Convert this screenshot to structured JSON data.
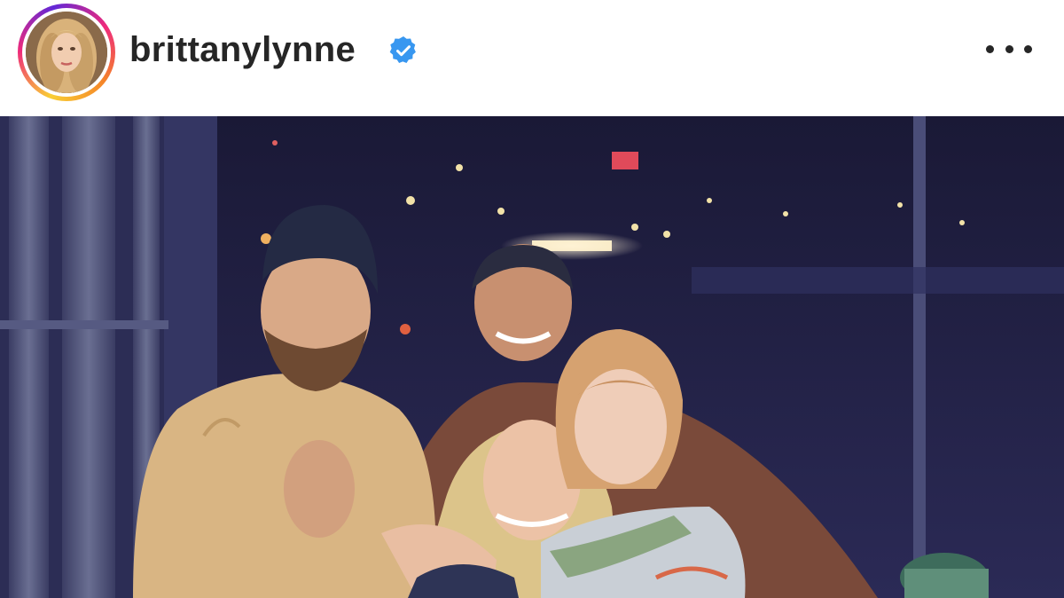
{
  "post": {
    "username": "brittanylynne",
    "verified": true,
    "avatar_icon": "profile-photo",
    "more_icon": "ellipsis-icon",
    "ring_colors": [
      "#f9ce34",
      "#ee2a7b",
      "#6228d7"
    ],
    "verified_color": "#3897f0"
  },
  "photo": {
    "description_icon": "post-photo"
  }
}
